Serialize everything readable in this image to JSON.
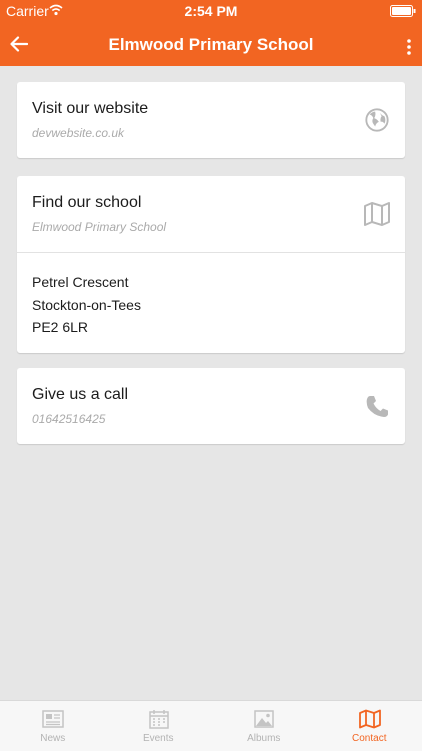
{
  "status_bar": {
    "carrier": "Carrier",
    "time": "2:54 PM"
  },
  "nav": {
    "title": "Elmwood Primary School",
    "back_icon": "arrow-left-icon",
    "menu_icon": "more-vertical-icon"
  },
  "cards": {
    "website": {
      "title": "Visit our website",
      "subtitle": "devwebsite.co.uk",
      "icon": "globe-icon"
    },
    "find": {
      "title": "Find our school",
      "subtitle": "Elmwood Primary School",
      "icon": "map-icon",
      "address": [
        "Petrel Crescent",
        "Stockton-on-Tees",
        "PE2 6LR"
      ]
    },
    "call": {
      "title": "Give us a call",
      "subtitle": "01642516425",
      "icon": "phone-icon"
    }
  },
  "tabs": [
    {
      "label": "News",
      "icon": "newspaper-icon",
      "active": false
    },
    {
      "label": "Events",
      "icon": "calendar-icon",
      "active": false
    },
    {
      "label": "Albums",
      "icon": "image-icon",
      "active": false
    },
    {
      "label": "Contact",
      "icon": "map-icon",
      "active": true
    }
  ],
  "colors": {
    "accent": "#f26522",
    "background": "#e6e6e6",
    "icon_gray": "#b8b8b8"
  }
}
